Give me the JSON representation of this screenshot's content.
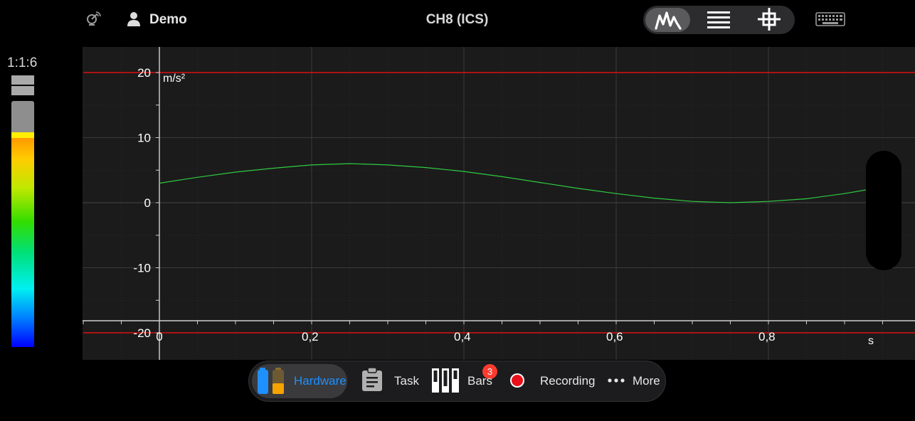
{
  "header": {
    "user_name": "Demo",
    "channel_title": "CH8 (ICS)",
    "icons": [
      "satellite-dish-icon",
      "user-icon",
      "waveform-icon",
      "list-icon",
      "crosshair-icon",
      "keyboard-icon"
    ]
  },
  "meter": {
    "label": "1:1:6",
    "level": 0.69
  },
  "chart_data": {
    "type": "line",
    "x_unit": "s",
    "y_unit": "m/s²",
    "xlim": [
      0,
      0.94
    ],
    "ylim": [
      -20,
      20
    ],
    "x_ticks": [
      "0",
      "0,2",
      "0,4",
      "0,6",
      "0,8"
    ],
    "x_tick_values": [
      0,
      0.2,
      0.4,
      0.6,
      0.8
    ],
    "y_ticks": [
      "20",
      "10",
      "0",
      "-10",
      "-20"
    ],
    "y_tick_values": [
      20,
      10,
      0,
      -10,
      -20
    ],
    "limit_lines": [
      20,
      -20
    ],
    "series": [
      {
        "color": "#2ecc40",
        "x": [
          0,
          0.05,
          0.1,
          0.15,
          0.2,
          0.25,
          0.3,
          0.35,
          0.4,
          0.45,
          0.5,
          0.55,
          0.6,
          0.65,
          0.7,
          0.75,
          0.8,
          0.85,
          0.9,
          0.94
        ],
        "y": [
          3.0,
          3.9,
          4.7,
          5.3,
          5.8,
          6.0,
          5.8,
          5.4,
          4.8,
          4.0,
          3.1,
          2.2,
          1.4,
          0.7,
          0.2,
          0.0,
          0.2,
          0.6,
          1.4,
          2.2
        ]
      }
    ],
    "colors": {
      "grid": "#3a3a3a",
      "axis": "#cfcfcf",
      "limit": "#e01010",
      "background": "#1b1b1b"
    }
  },
  "toolbar": {
    "hardware_label": "Hardware",
    "task_label": "Task",
    "bars_label": "Bars",
    "bars_badge": "3",
    "recording_label": "Recording",
    "more_label": "More",
    "accent_color": "#1e90ff"
  }
}
